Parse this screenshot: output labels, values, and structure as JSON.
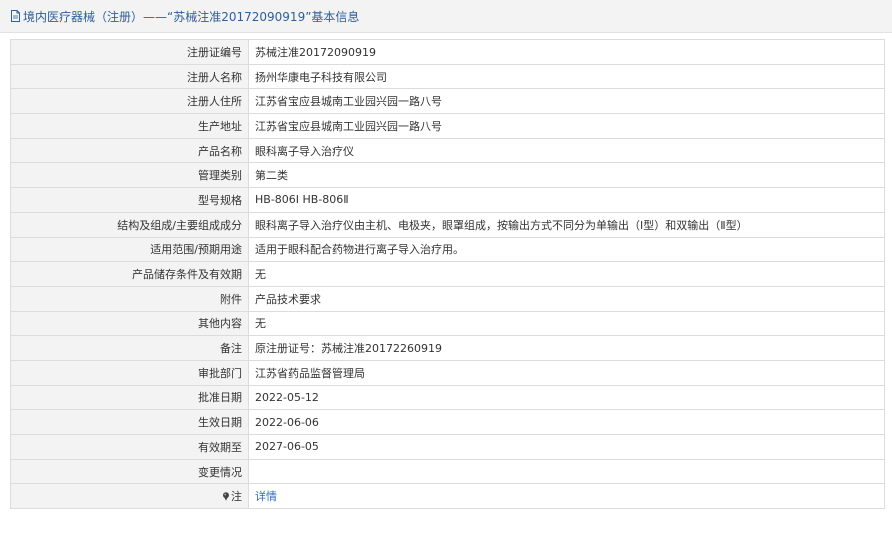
{
  "header": {
    "title": "境内医疗器械（注册）——“苏械注准20172090919”基本信息",
    "icon": "document-icon",
    "color": "#2d5f9a"
  },
  "rows": [
    {
      "label": "注册证编号",
      "value": "苏械注准20172090919"
    },
    {
      "label": "注册人名称",
      "value": "扬州华康电子科技有限公司"
    },
    {
      "label": "注册人住所",
      "value": "江苏省宝应县城南工业园兴园一路八号"
    },
    {
      "label": "生产地址",
      "value": "江苏省宝应县城南工业园兴园一路八号"
    },
    {
      "label": "产品名称",
      "value": "眼科离子导入治疗仪"
    },
    {
      "label": "管理类别",
      "value": "第二类"
    },
    {
      "label": "型号规格",
      "value": "HB-806Ⅰ HB-806Ⅱ"
    },
    {
      "label": "结构及组成/主要组成成分",
      "value": "眼科离子导入治疗仪由主机、电极夹，眼罩组成，按输出方式不同分为单输出（Ⅰ型）和双输出（Ⅱ型）"
    },
    {
      "label": "适用范围/预期用途",
      "value": "适用于眼科配合药物进行离子导入治疗用。"
    },
    {
      "label": "产品储存条件及有效期",
      "value": "无"
    },
    {
      "label": "附件",
      "value": "产品技术要求"
    },
    {
      "label": "其他内容",
      "value": "无"
    },
    {
      "label": "备注",
      "value": "原注册证号：苏械注准20172260919"
    },
    {
      "label": "审批部门",
      "value": "江苏省药品监督管理局"
    },
    {
      "label": "批准日期",
      "value": "2022-05-12"
    },
    {
      "label": "生效日期",
      "value": "2022-06-06"
    },
    {
      "label": "有效期至",
      "value": "2027-06-05"
    },
    {
      "label": "变更情况",
      "value": ""
    }
  ],
  "note_row": {
    "label": "注",
    "icon": "pin-icon",
    "link_text": "详情",
    "link_color": "#2d6bbd"
  }
}
